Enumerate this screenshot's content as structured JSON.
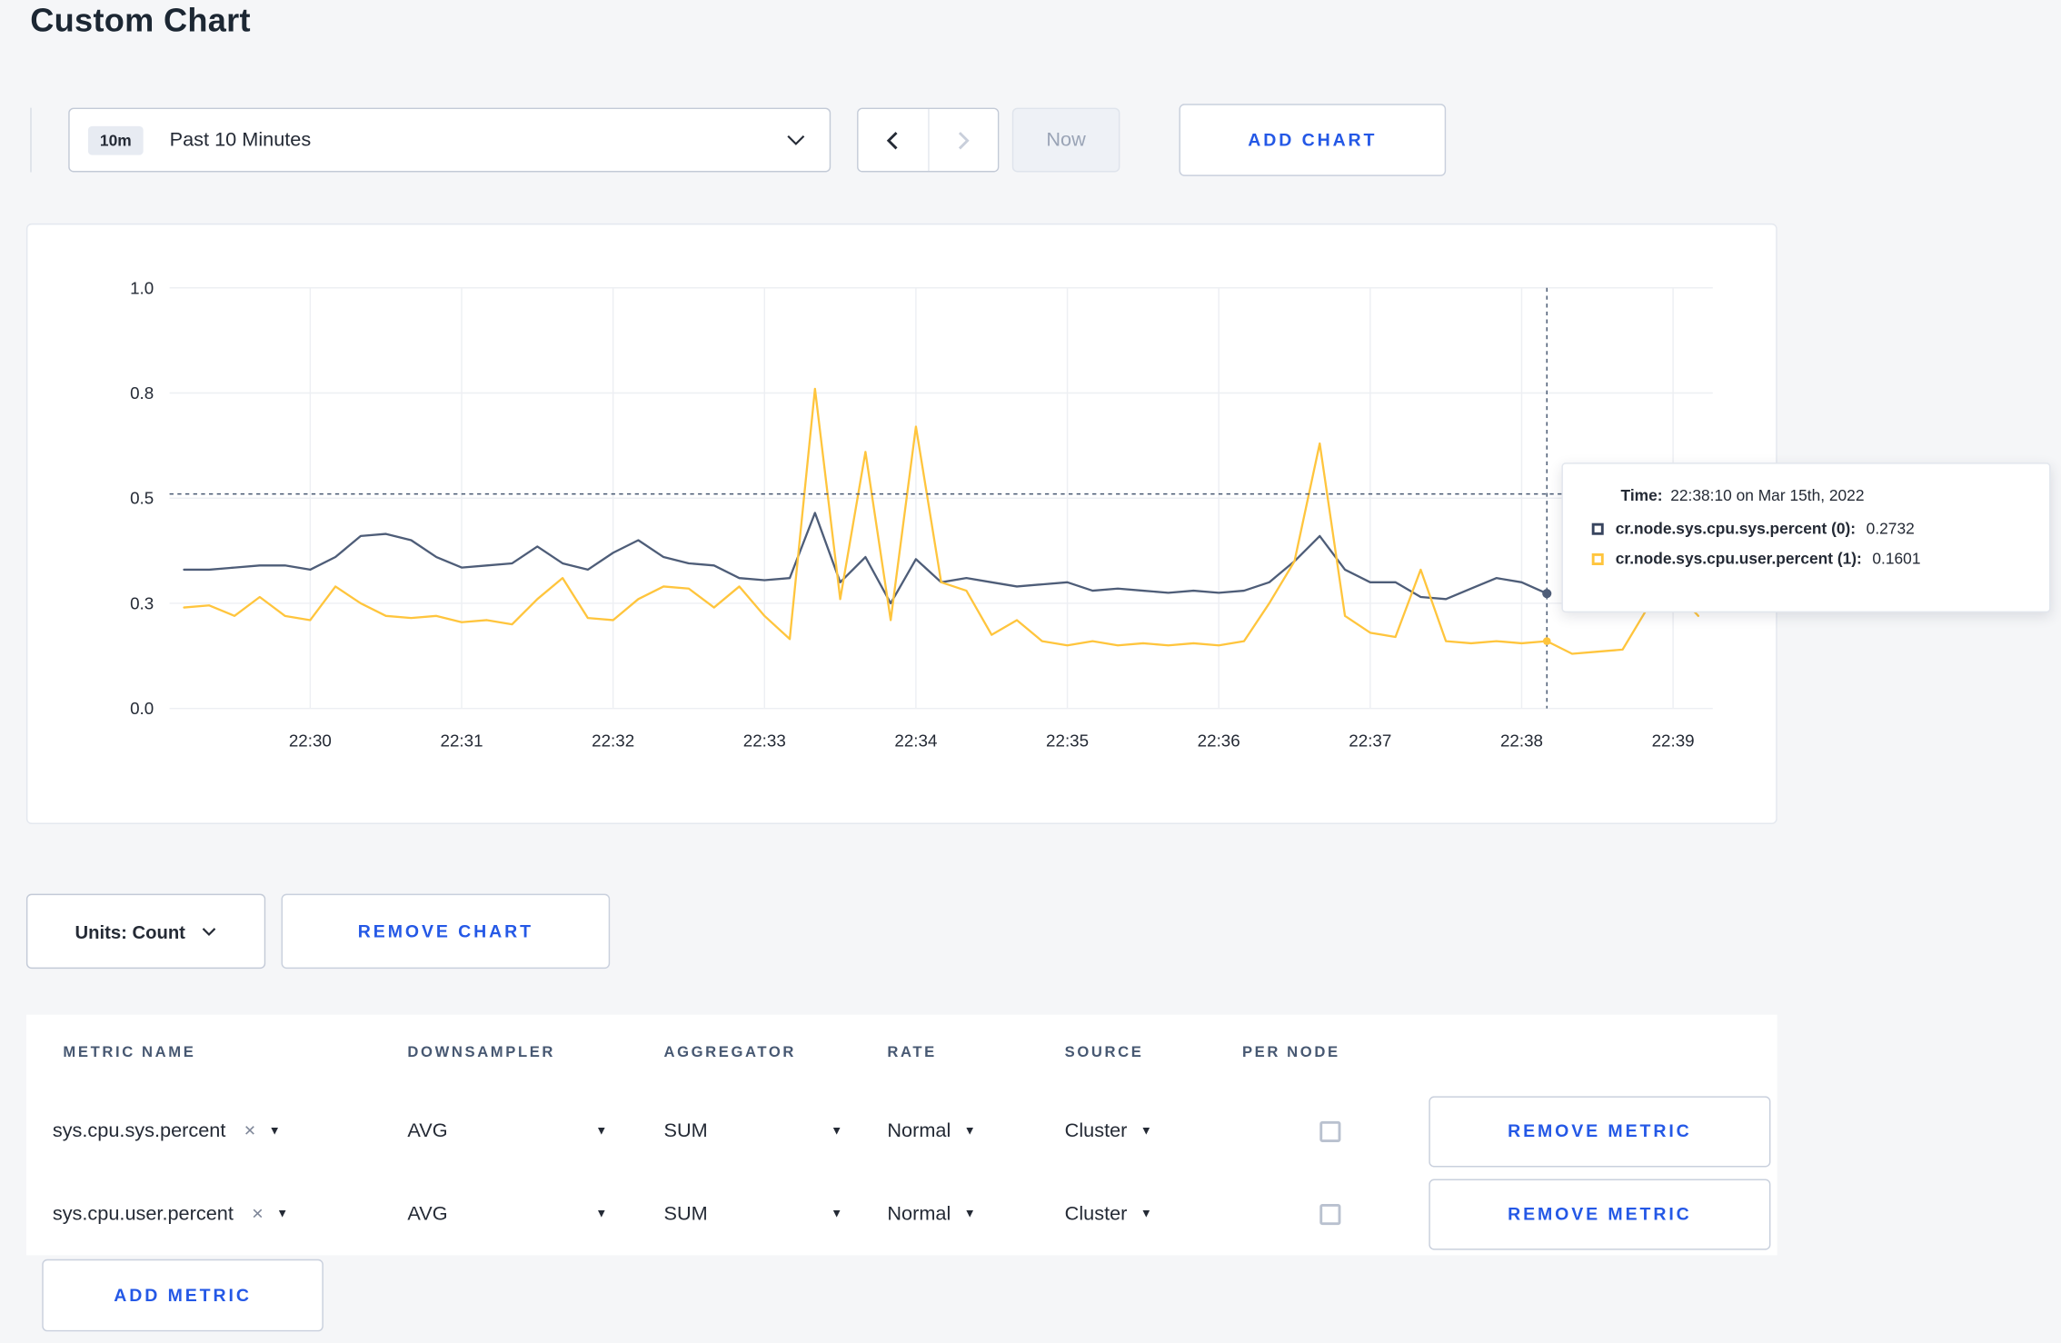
{
  "colors": {
    "accent": "#2458e6",
    "text": "#242a35",
    "series_sys": "#4e5d78",
    "series_user": "#ffc53d",
    "crosshair": "#475872",
    "grid": "#edeff3"
  },
  "icons": {
    "caret_down": "▼",
    "clear": "×"
  },
  "header": {
    "title": "Custom Chart"
  },
  "toolbar": {
    "range_badge": "10m",
    "range_label": "Past 10 Minutes",
    "now_label": "Now",
    "add_chart_label": "ADD CHART"
  },
  "chart_controls": {
    "units_label": "Units: Count",
    "remove_chart_label": "REMOVE CHART"
  },
  "tooltip": {
    "time_label": "Time:",
    "time_value": "22:38:10 on Mar 15th, 2022",
    "rows": [
      {
        "label": "cr.node.sys.cpu.sys.percent (0):",
        "value": "0.2732",
        "color": "#37445e"
      },
      {
        "label": "cr.node.sys.cpu.user.percent (1):",
        "value": "0.1601",
        "color": "#ffc53d"
      }
    ]
  },
  "metric_table": {
    "headers": [
      "METRIC NAME",
      "DOWNSAMPLER",
      "AGGREGATOR",
      "RATE",
      "SOURCE",
      "PER NODE"
    ],
    "rows": [
      {
        "metric": "sys.cpu.sys.percent",
        "downsampler": "AVG",
        "aggregator": "SUM",
        "rate": "Normal",
        "source": "Cluster",
        "per_node_checked": false,
        "remove_label": "REMOVE METRIC"
      },
      {
        "metric": "sys.cpu.user.percent",
        "downsampler": "AVG",
        "aggregator": "SUM",
        "rate": "Normal",
        "source": "Cluster",
        "per_node_checked": false,
        "remove_label": "REMOVE METRIC"
      }
    ],
    "add_metric_label": "ADD METRIC"
  },
  "chart_data": {
    "type": "line",
    "title": "",
    "xlabel": "",
    "ylabel": "",
    "ylim": [
      0,
      1
    ],
    "grid": true,
    "legend_position": "tooltip",
    "x_ticks": [
      "22:30",
      "22:31",
      "22:32",
      "22:33",
      "22:34",
      "22:35",
      "22:36",
      "22:37",
      "22:38",
      "22:39"
    ],
    "y_ticks": [
      {
        "label": "0.0",
        "value": 0
      },
      {
        "label": "0.3",
        "value": 0.25
      },
      {
        "label": "0.5",
        "value": 0.5
      },
      {
        "label": "0.8",
        "value": 0.75
      },
      {
        "label": "1.0",
        "value": 1
      }
    ],
    "start_time": "22:29:10",
    "interval_seconds": 10,
    "series": [
      {
        "name": "cr.node.sys.cpu.sys.percent",
        "color": "#4e5d78",
        "values": [
          0.33,
          0.33,
          0.335,
          0.34,
          0.34,
          0.33,
          0.36,
          0.41,
          0.415,
          0.4,
          0.36,
          0.335,
          0.34,
          0.345,
          0.385,
          0.345,
          0.33,
          0.37,
          0.4,
          0.36,
          0.345,
          0.34,
          0.31,
          0.305,
          0.31,
          0.465,
          0.3,
          0.36,
          0.25,
          0.355,
          0.3,
          0.31,
          0.3,
          0.29,
          0.295,
          0.3,
          0.28,
          0.285,
          0.28,
          0.275,
          0.28,
          0.275,
          0.28,
          0.3,
          0.35,
          0.41,
          0.33,
          0.3,
          0.3,
          0.265,
          0.26,
          0.285,
          0.31,
          0.3,
          0.2732
        ]
      },
      {
        "name": "cr.node.sys.cpu.user.percent",
        "color": "#ffc53d",
        "values": [
          0.24,
          0.245,
          0.22,
          0.265,
          0.22,
          0.21,
          0.29,
          0.25,
          0.22,
          0.215,
          0.22,
          0.205,
          0.21,
          0.2,
          0.26,
          0.31,
          0.215,
          0.21,
          0.26,
          0.29,
          0.285,
          0.24,
          0.29,
          0.22,
          0.165,
          0.76,
          0.26,
          0.61,
          0.21,
          0.67,
          0.3,
          0.28,
          0.175,
          0.21,
          0.16,
          0.15,
          0.16,
          0.15,
          0.155,
          0.15,
          0.155,
          0.15,
          0.16,
          0.25,
          0.35,
          0.63,
          0.22,
          0.18,
          0.17,
          0.33,
          0.16,
          0.155,
          0.16,
          0.155,
          0.1601,
          0.13,
          0.135,
          0.14,
          0.24,
          0.285,
          0.22
        ]
      }
    ],
    "crosshair": {
      "time": "22:38:10",
      "x_index": 54,
      "y_value": 0.51,
      "points": [
        {
          "series": 0,
          "value": 0.2732
        },
        {
          "series": 1,
          "value": 0.1601
        }
      ]
    }
  }
}
